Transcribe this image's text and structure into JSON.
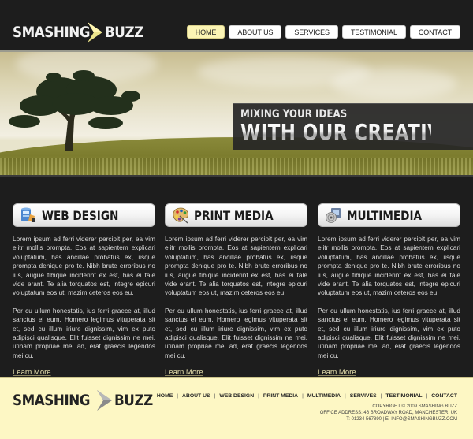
{
  "brand": {
    "name_part1": "SMASHING",
    "name_part2": "BUZZ",
    "accent_color": "#fbf4b4",
    "arrow_color": "#e9e28a"
  },
  "nav": {
    "items": [
      {
        "label": "HOME",
        "active": true
      },
      {
        "label": "ABOUT US",
        "active": false
      },
      {
        "label": "SERVICES",
        "active": false
      },
      {
        "label": "TESTIMONIAL",
        "active": false
      },
      {
        "label": "CONTACT",
        "active": false
      }
    ]
  },
  "banner": {
    "tagline_line1": "MIXING YOUR IDEAS",
    "tagline_line2": "WITH OUR CREATIVITY"
  },
  "columns": [
    {
      "title": "WEB DESIGN",
      "icon": "web-design-icon",
      "paragraph1": "Lorem ipsum ad ferri viderer percipit per, ea vim elitr mollis prompta. Eos at sapientem explicari voluptatum, has ancillae probatus ex, iisque prompta denique pro te. Nibh brute erroribus no ius, augue tibique inciderint ex est, has ei tale vide erant. Te alia torquatos est, integre epicuri voluptatum eos ut, mazim ceteros eos eu.",
      "paragraph2": "Per cu ullum honestatis, ius ferri graece at, illud sanctus ei eum. Homero legimus vituperata sit et, sed cu illum iriure dignissim, vim ex puto adipisci qualisque. Elit fuisset dignissim ne mei, utinam propriae mei ad, erat graecis legendos mei cu.",
      "link": "Learn More"
    },
    {
      "title": "PRINT MEDIA",
      "icon": "palette-icon",
      "paragraph1": "Lorem ipsum ad ferri viderer percipit per, ea vim elitr mollis prompta. Eos at sapientem explicari voluptatum, has ancillae probatus ex, iisque prompta denique pro te. Nibh brute erroribus no ius, augue tibique inciderint ex est, has ei tale vide erant. Te alia torquatos est, integre epicuri voluptatum eos ut, mazim ceteros eos eu.",
      "paragraph2": "Per cu ullum honestatis, ius ferri graece at, illud sanctus ei eum. Homero legimus vituperata sit et, sed cu illum iriure dignissim, vim ex puto adipisci qualisque. Elit fuisset dignissim ne mei, utinam propriae mei ad, erat graecis legendos mei cu.",
      "link": "Learn More"
    },
    {
      "title": "MULTIMEDIA",
      "icon": "multimedia-icon",
      "paragraph1": "Lorem ipsum ad ferri viderer percipit per, ea vim elitr mollis prompta. Eos at sapientem explicari voluptatum, has ancillae probatus ex, iisque prompta denique pro te. Nibh brute erroribus no ius, augue tibique inciderint ex est, has ei tale vide erant. Te alia torquatos est, integre epicuri voluptatum eos ut, mazim ceteros eos eu.",
      "paragraph2": "Per cu ullum honestatis, ius ferri graece at, illud sanctus ei eum. Homero legimus vituperata sit et, sed cu illum iriure dignissim, vim ex puto adipisci qualisque. Elit fuisset dignissim ne mei, utinam propriae mei ad, erat graecis legendos mei cu.",
      "link": "Learn More"
    }
  ],
  "footer": {
    "separator": "|",
    "nav": [
      "HOME",
      "ABOUT US",
      "WEB DESIGN",
      "PRINT MEDIA",
      "MULTIMEDIA",
      "SERVIVES",
      "TESTIMONIAL",
      "CONTACT"
    ],
    "copyright": "COPYRIGHT © 2009 SMASHING BUZZ",
    "address": "OFFICE ADDRESS: 46 BROADWAY ROAD, MANCHESTER, UK",
    "contact": "T: 01234 567890 | E: INFO@SMASHINGBUZZ.COM"
  }
}
